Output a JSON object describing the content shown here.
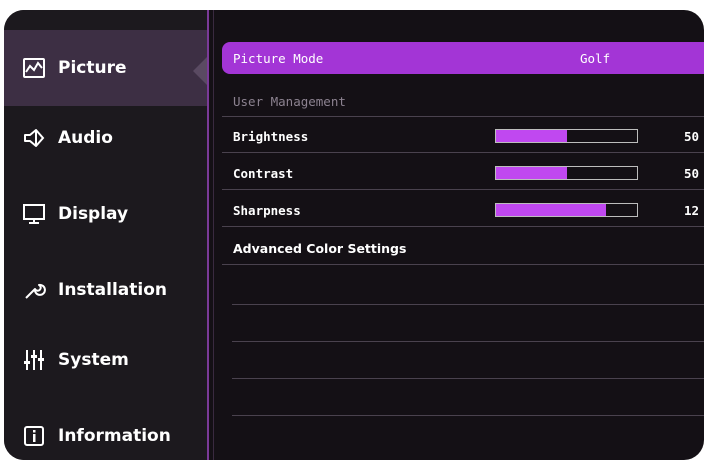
{
  "sidebar": {
    "items": [
      {
        "label": "Picture",
        "icon": "picture-icon",
        "active": true
      },
      {
        "label": "Audio",
        "icon": "speaker-icon",
        "active": false
      },
      {
        "label": "Display",
        "icon": "monitor-icon",
        "active": false
      },
      {
        "label": "Installation",
        "icon": "wrench-icon",
        "active": false
      },
      {
        "label": "System",
        "icon": "sliders-icon",
        "active": false
      },
      {
        "label": "Information",
        "icon": "info-icon",
        "active": false
      }
    ]
  },
  "main": {
    "picture_mode": {
      "label": "Picture Mode",
      "value": "Golf"
    },
    "user_management": {
      "label": "User Management"
    },
    "brightness": {
      "label": "Brightness",
      "value": "50",
      "fraction": 0.5
    },
    "contrast": {
      "label": "Contrast",
      "value": "50",
      "fraction": 0.5
    },
    "sharpness": {
      "label": "Sharpness",
      "value": "12",
      "fraction": 0.78
    },
    "advanced": {
      "label": "Advanced Color Settings"
    }
  },
  "colors": {
    "accent": "#a335d6",
    "bar_fill": "#c048f0",
    "sidebar_active": "#3d2f44",
    "background": "#141015"
  }
}
